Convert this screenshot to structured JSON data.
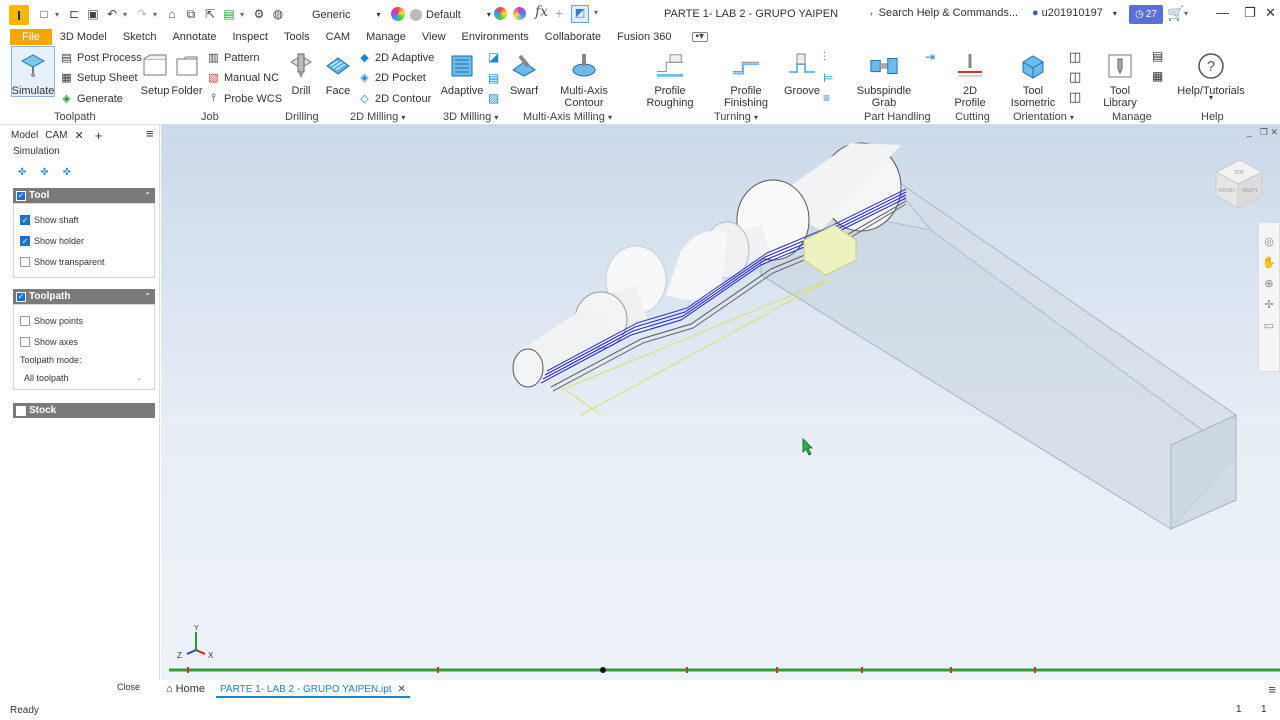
{
  "titlebar": {
    "app_letter": "I",
    "appearance": "Generic",
    "material": "Default",
    "doc_title": "PARTE 1- LAB 2 - GRUPO YAIPEN",
    "search_placeholder": "Search Help & Commands...",
    "user": "u201910197",
    "notif_count": "27"
  },
  "tabs": [
    "File",
    "3D Model",
    "Sketch",
    "Annotate",
    "Inspect",
    "Tools",
    "CAM",
    "Manage",
    "View",
    "Environments",
    "Collaborate",
    "Fusion 360"
  ],
  "ribbon": {
    "simulate": "Simulate",
    "post_process": "Post Process",
    "setup_sheet": "Setup Sheet",
    "generate": "Generate",
    "setup": "Setup",
    "folder": "Folder",
    "pattern": "Pattern",
    "manual_nc": "Manual NC",
    "probe_wcs": "Probe WCS",
    "drill": "Drill",
    "face": "Face",
    "adaptive_2d": "2D Adaptive",
    "pocket_2d": "2D Pocket",
    "contour_2d": "2D Contour",
    "adaptive": "Adaptive",
    "swarf": "Swarf",
    "multi_axis_contour": "Multi-Axis Contour",
    "profile_roughing": "Profile Roughing",
    "profile_finishing": "Profile Finishing",
    "groove": "Groove",
    "subspindle_grab": "Subspindle Grab",
    "profile_2d": "2D Profile",
    "tool_isometric": "Tool Isometric",
    "tool_library": "Tool Library",
    "help_tutorials": "Help/Tutorials",
    "groups": {
      "toolpath": "Toolpath",
      "job": "Job",
      "drilling": "Drilling",
      "milling_2d": "2D Milling",
      "milling_3d": "3D Milling",
      "multi_axis": "Multi-Axis Milling",
      "turning": "Turning",
      "part_handling": "Part Handling",
      "cutting": "Cutting",
      "orientation": "Orientation",
      "manage": "Manage",
      "help": "Help"
    }
  },
  "panel": {
    "tab_model": "Model",
    "tab_cam": "CAM",
    "simulation": "Simulation",
    "tool_section": "Tool",
    "show_shaft": "Show shaft",
    "show_holder": "Show holder",
    "show_transparent": "Show transparent",
    "toolpath_section": "Toolpath",
    "show_points": "Show points",
    "show_axes": "Show axes",
    "toolpath_mode_label": "Toolpath mode:",
    "toolpath_mode_value": "All toolpath",
    "stock_section": "Stock",
    "close": "Close"
  },
  "viewcube": {
    "top": "TOP",
    "front": "FRONT",
    "right": "RIGHT"
  },
  "triad": {
    "x": "X",
    "y": "Y",
    "z": "Z"
  },
  "doctabs": {
    "home": "Home",
    "file": "PARTE 1- LAB 2 - GRUPO YAIPEN.ipt"
  },
  "status": {
    "text": "Ready",
    "n1": "1",
    "n2": "1"
  },
  "colors": {
    "accent": "#1d6fd1",
    "file_tab": "#f5a700",
    "timeline": "#3a9a3a"
  }
}
